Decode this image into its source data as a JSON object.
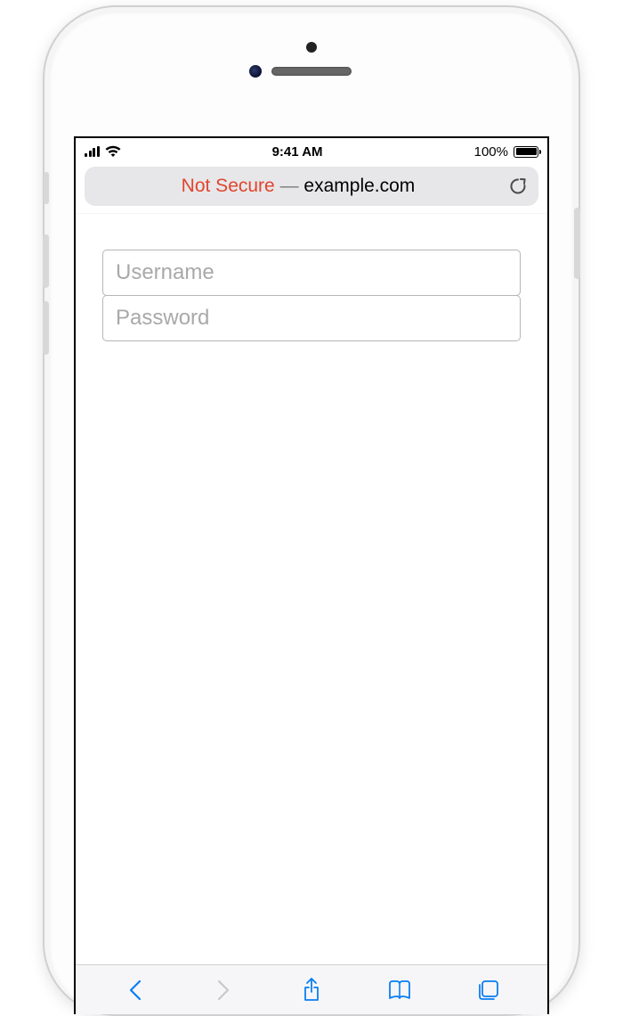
{
  "status": {
    "time": "9:41 AM",
    "battery_pct": "100%"
  },
  "urlbar": {
    "security_label": "Not Secure",
    "separator": "—",
    "domain": "example.com"
  },
  "form": {
    "username_placeholder": "Username",
    "password_placeholder": "Password"
  },
  "colors": {
    "not_secure": "#e0452c",
    "tint": "#0a7ef2"
  }
}
